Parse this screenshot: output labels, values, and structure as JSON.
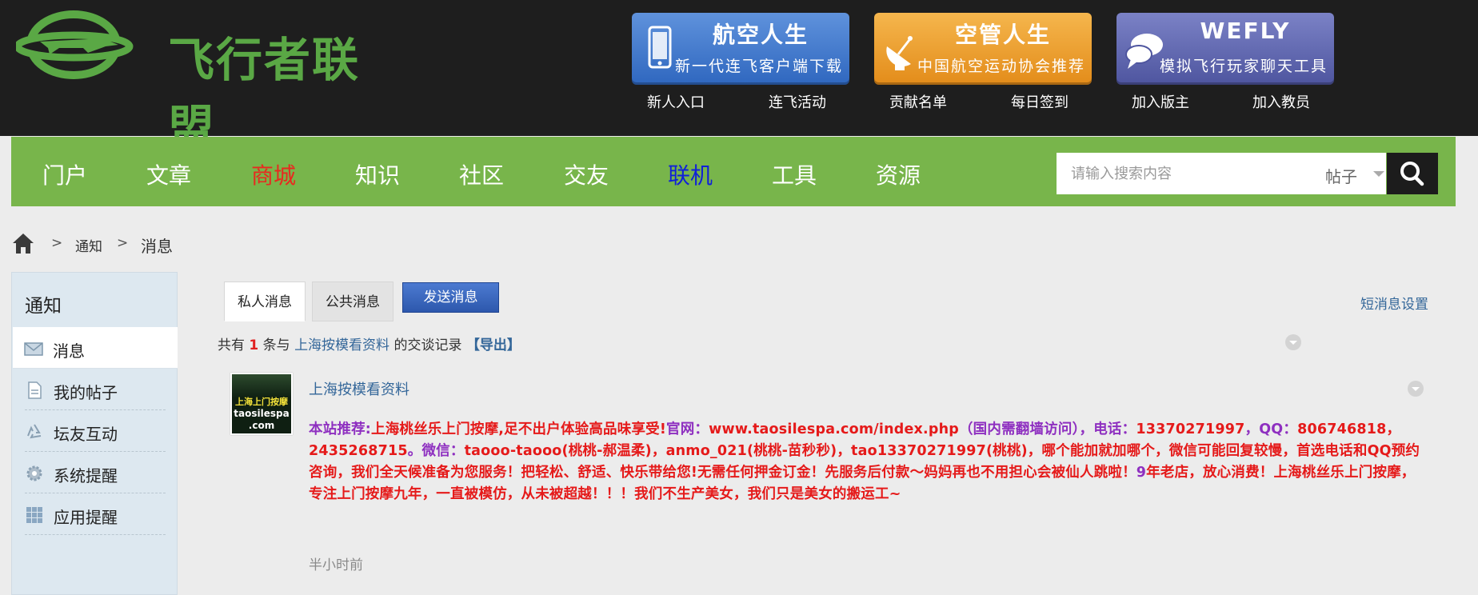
{
  "site": {
    "logo_text": "飞行者联盟",
    "brand_color": "#5aa845"
  },
  "banners": [
    {
      "title": "航空人生",
      "subtitle": "新一代连飞客户端下载",
      "icon": "phone-icon"
    },
    {
      "title": "空管人生",
      "subtitle": "中国航空运动协会推荐",
      "icon": "radar-dish-icon"
    },
    {
      "title": "WEFLY",
      "subtitle": "模拟飞行玩家聊天工具",
      "icon": "chat-bubble-icon"
    }
  ],
  "top_links": [
    "新人入口",
    "连飞活动",
    "贡献名单",
    "每日签到",
    "加入版主",
    "加入教员"
  ],
  "nav": {
    "items": [
      {
        "label": "门户",
        "color": "#ffffff"
      },
      {
        "label": "文章",
        "color": "#ffffff"
      },
      {
        "label": "商城",
        "color": "#e8291f"
      },
      {
        "label": "知识",
        "color": "#ffffff"
      },
      {
        "label": "社区",
        "color": "#ffffff"
      },
      {
        "label": "交友",
        "color": "#ffffff"
      },
      {
        "label": "联机",
        "color": "#1020d8"
      },
      {
        "label": "工具",
        "color": "#ffffff"
      },
      {
        "label": "资源",
        "color": "#ffffff"
      }
    ],
    "bg_color": "#78b54b",
    "search_placeholder": "请输入搜索内容",
    "search_type": "帖子"
  },
  "breadcrumb": {
    "sep": ">",
    "items": [
      "通知",
      "消息"
    ]
  },
  "sidebar": {
    "title": "通知",
    "items": [
      {
        "label": "消息",
        "icon": "envelope-icon",
        "active": true
      },
      {
        "label": "我的帖子",
        "icon": "document-icon",
        "active": false
      },
      {
        "label": "坛友互动",
        "icon": "recycle-icon",
        "active": false
      },
      {
        "label": "系统提醒",
        "icon": "gear-icon",
        "active": false
      },
      {
        "label": "应用提醒",
        "icon": "grid-icon",
        "active": false
      }
    ]
  },
  "tabs": [
    {
      "label": "私人消息",
      "active": true
    },
    {
      "label": "公共消息",
      "active": false
    }
  ],
  "send_button": "发送消息",
  "settings_link": "短消息设置",
  "summary": {
    "prefix": "共有",
    "count": "1",
    "mid": "条与",
    "user": "上海按模看资料",
    "suffix": "的交谈记录",
    "export": "【导出】"
  },
  "message": {
    "author": "上海按模看资料",
    "avatar_lines": [
      "上海上门按摩",
      "taosilespa",
      ".com"
    ],
    "segments": [
      {
        "text": "本站推荐:",
        "red": false
      },
      {
        "text": "上海桃丝乐上门按摩,足不出户体验高品味享受!",
        "red": true
      },
      {
        "text": "官网：",
        "red": false
      },
      {
        "text": "www.taosilespa.com/index.php",
        "red": true
      },
      {
        "text": "（国内需翻墙访问），电话：",
        "red": false
      },
      {
        "text": "13370271997",
        "red": true
      },
      {
        "text": "，QQ：",
        "red": false
      },
      {
        "text": "806746818，2435268715",
        "red": true
      },
      {
        "text": "。微信：",
        "red": false
      },
      {
        "text": "taooo-taooo(桃桃-郝温柔)，anmo_021(桃桃-苗秒秒)，tao13370271997(桃桃)，哪个能加就加哪个，微信可能回复较慢，首选电话和QQ预约咨询，我们全天候准备为您服务！把轻松、舒适、快乐带给您!无需任何押金订金！先服务后付款～妈妈再也不用担心会被仙人跳啦！",
        "red": true
      },
      {
        "text": "9",
        "red": false
      },
      {
        "text": "年老店，放心消费！上海桃丝乐上门按摩，专注上门按摩九年，一直被模仿，从未被超越！！！我们不生产美女，我们只是美女的搬运工~",
        "red": true
      }
    ],
    "time": "半小时前"
  }
}
